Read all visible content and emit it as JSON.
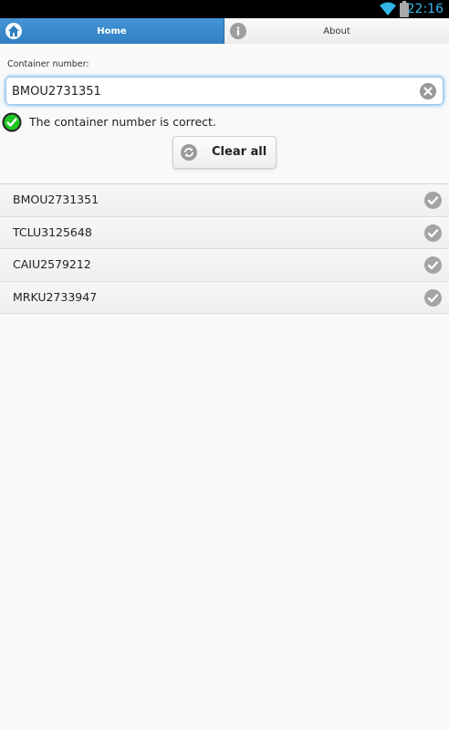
{
  "status_bar": {
    "time": "22:16",
    "wifi_icon": "wifi-icon",
    "battery_icon": "battery-icon"
  },
  "tabs": [
    {
      "label": "Home",
      "icon": "home-icon",
      "active": true
    },
    {
      "label": "About",
      "icon": "info-icon",
      "active": false
    }
  ],
  "form": {
    "label": "Container number:",
    "value": "BMOU2731351",
    "validation_message": "The container number is correct.",
    "validation_icon": "check-circle-icon"
  },
  "clear_button": {
    "label": "Clear all",
    "icon": "refresh-icon"
  },
  "history": [
    {
      "number": "BMOU2731351"
    },
    {
      "number": "TCLU3125648"
    },
    {
      "number": "CAIU2579212"
    },
    {
      "number": "MRKU2733947"
    }
  ],
  "colors": {
    "accent": "#3b8ccd",
    "status_ok": "#22c422",
    "status_bar_text": "#33b5e5"
  }
}
